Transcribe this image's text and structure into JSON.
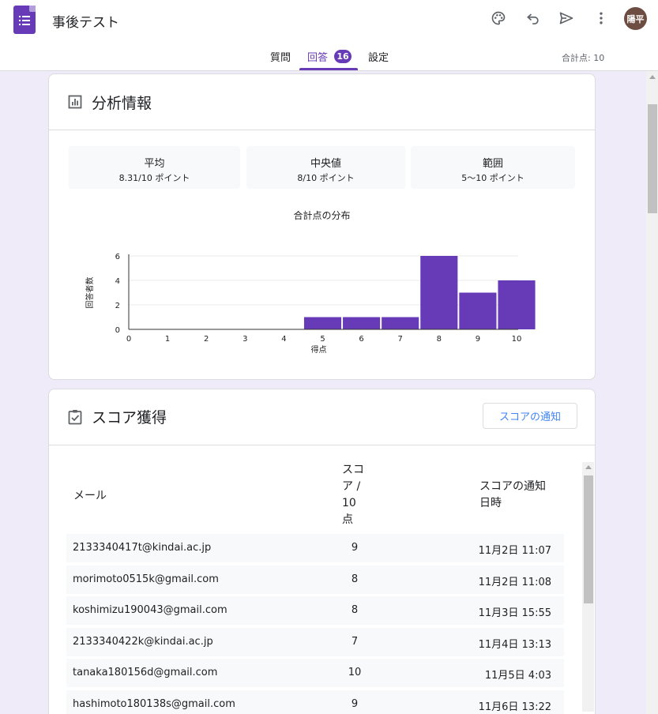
{
  "app": {
    "title": "事後テスト",
    "avatar_initials": "陽平",
    "brand_color": "#673ab7"
  },
  "header_icons": [
    "palette-icon",
    "undo-icon",
    "send-icon",
    "more-vert-icon"
  ],
  "tabs": [
    {
      "label": "質問",
      "active": false
    },
    {
      "label": "回答",
      "active": true,
      "badge": "16"
    },
    {
      "label": "設定",
      "active": false
    }
  ],
  "total_points": "合計点: 10",
  "analytics": {
    "title": "分析情報",
    "stats": [
      {
        "label": "平均",
        "value": "8.31/10 ポイント"
      },
      {
        "label": "中央値",
        "value": "8/10 ポイント"
      },
      {
        "label": "範囲",
        "value": "5〜10 ポイント"
      }
    ]
  },
  "chart_data": {
    "type": "bar",
    "title": "合計点の分布",
    "xlabel": "得点",
    "ylabel": "回答者数",
    "categories": [
      "0",
      "1",
      "2",
      "3",
      "4",
      "5",
      "6",
      "7",
      "8",
      "9",
      "10"
    ],
    "values": [
      0,
      0,
      0,
      0,
      0,
      1,
      1,
      1,
      6,
      3,
      4
    ],
    "ylim": [
      0,
      6
    ],
    "yticks": [
      "0",
      "2",
      "4",
      "6"
    ],
    "bar_color": "#673ab7",
    "grid": true
  },
  "scores": {
    "title": "スコア獲得",
    "notify_button": "スコアの通知",
    "headers": {
      "email": "メール",
      "score": [
        "スコ",
        "ア /",
        "10",
        "点"
      ],
      "notified": [
        "スコアの通知",
        "日時"
      ]
    },
    "rows": [
      {
        "email": "2133340417t@kindai.ac.jp",
        "score": "9",
        "time": "11月2日 11:07"
      },
      {
        "email": "morimoto0515k@gmail.com",
        "score": "8",
        "time": "11月2日 11:08"
      },
      {
        "email": "koshimizu190043@gmail.com",
        "score": "8",
        "time": "11月3日 15:55"
      },
      {
        "email": "2133340422k@kindai.ac.jp",
        "score": "7",
        "time": "11月4日 13:13"
      },
      {
        "email": "tanaka180156d@gmail.com",
        "score": "10",
        "time": "11月5日 4:03"
      },
      {
        "email": "hashimoto180138s@gmail.com",
        "score": "9",
        "time": "11月6日 13:22"
      }
    ]
  }
}
